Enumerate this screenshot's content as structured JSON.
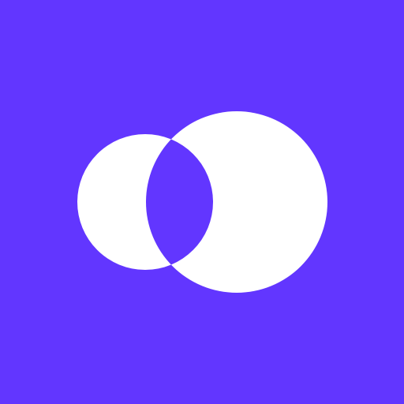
{
  "icon": {
    "name": "overlapping-circles-logo",
    "colors": {
      "background": "#6236FF",
      "shape": "#FFFFFF"
    }
  }
}
